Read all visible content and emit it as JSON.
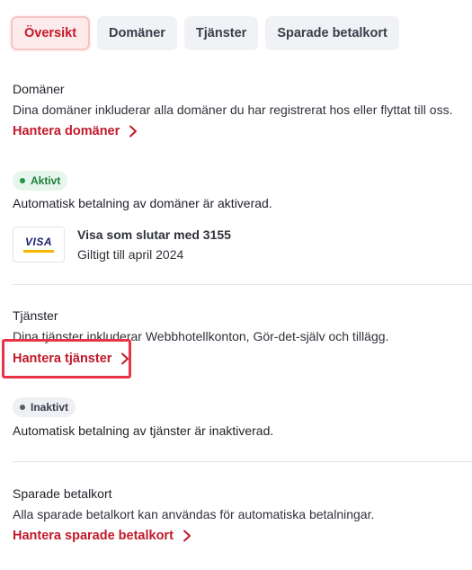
{
  "tabs": [
    {
      "label": "Översikt",
      "active": true
    },
    {
      "label": "Domäner",
      "active": false
    },
    {
      "label": "Tjänster",
      "active": false
    },
    {
      "label": "Sparade betalkort",
      "active": false
    }
  ],
  "domains": {
    "title": "Domäner",
    "description": "Dina domäner inkluderar alla domäner du har registrerat hos eller flyttat till oss.",
    "link": "Hantera domäner",
    "status_badge": "Aktivt",
    "status_text": "Automatisk betalning av domäner är aktiverad.",
    "card": {
      "brand": "VISA",
      "name": "Visa som slutar med 3155",
      "expiry": "Giltigt till april 2024"
    }
  },
  "services": {
    "title": "Tjänster",
    "description": "Dina tjänster inkluderar Webbhotellkonton, Gör-det-själv och tillägg.",
    "link": "Hantera tjänster",
    "status_badge": "Inaktivt",
    "status_text": "Automatisk betalning av tjänster är inaktiverad."
  },
  "saved_cards": {
    "title": "Sparade betalkort",
    "description": "Alla sparade betalkort kan användas för automatiska betalningar.",
    "link": "Hantera sparade betalkort"
  },
  "colors": {
    "accent": "#c11a2a",
    "active_green": "#1b7f3a",
    "highlight": "#ea3347"
  },
  "icons": {
    "link_chevron": "chevron-right-icon",
    "status_dot": "dot-icon"
  }
}
